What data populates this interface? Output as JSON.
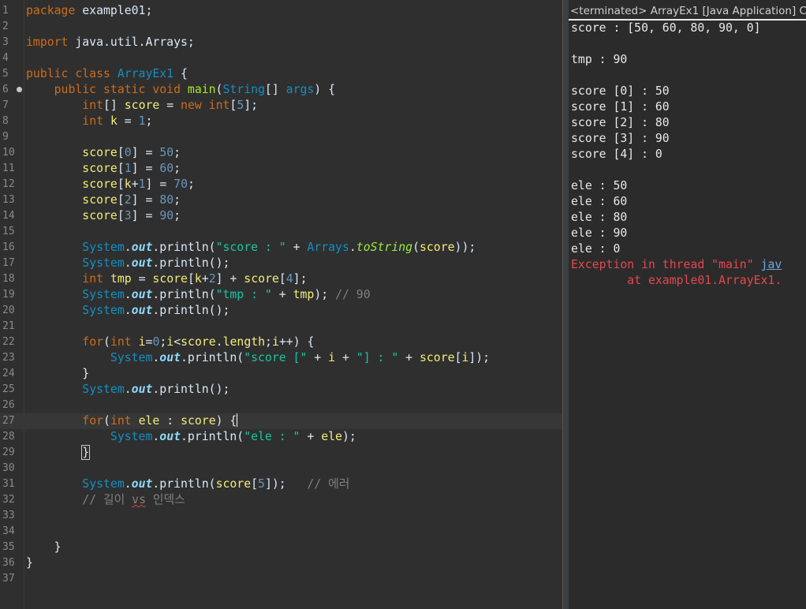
{
  "editor": {
    "lines": [
      {
        "n": "1",
        "tokens": [
          {
            "c": "kw",
            "t": "package"
          },
          {
            "c": "plain",
            "t": " example01;"
          }
        ]
      },
      {
        "n": "2",
        "tokens": []
      },
      {
        "n": "3",
        "tokens": [
          {
            "c": "kw",
            "t": "import"
          },
          {
            "c": "plain",
            "t": " java.util.Arrays;"
          }
        ]
      },
      {
        "n": "4",
        "tokens": []
      },
      {
        "n": "5",
        "tokens": [
          {
            "c": "kw",
            "t": "public class "
          },
          {
            "c": "cls",
            "t": "ArrayEx1"
          },
          {
            "c": "plain",
            "t": " {"
          }
        ]
      },
      {
        "n": "6",
        "fold": true,
        "tokens": [
          {
            "c": "plain",
            "t": "    "
          },
          {
            "c": "kw",
            "t": "public static void "
          },
          {
            "c": "mth",
            "t": "main"
          },
          {
            "c": "plain",
            "t": "("
          },
          {
            "c": "cls",
            "t": "String"
          },
          {
            "c": "plain",
            "t": "[] "
          },
          {
            "c": "type",
            "t": "args"
          },
          {
            "c": "plain",
            "t": ") {"
          }
        ]
      },
      {
        "n": "7",
        "tokens": [
          {
            "c": "plain",
            "t": "        "
          },
          {
            "c": "kw",
            "t": "int"
          },
          {
            "c": "plain",
            "t": "[] "
          },
          {
            "c": "var",
            "t": "score"
          },
          {
            "c": "plain",
            "t": " = "
          },
          {
            "c": "kw",
            "t": "new int"
          },
          {
            "c": "plain",
            "t": "["
          },
          {
            "c": "num",
            "t": "5"
          },
          {
            "c": "plain",
            "t": "];"
          }
        ]
      },
      {
        "n": "8",
        "tokens": [
          {
            "c": "plain",
            "t": "        "
          },
          {
            "c": "kw",
            "t": "int"
          },
          {
            "c": "plain",
            "t": " "
          },
          {
            "c": "var",
            "t": "k"
          },
          {
            "c": "plain",
            "t": " = "
          },
          {
            "c": "num",
            "t": "1"
          },
          {
            "c": "plain",
            "t": ";"
          }
        ]
      },
      {
        "n": "9",
        "tokens": []
      },
      {
        "n": "10",
        "tokens": [
          {
            "c": "plain",
            "t": "        "
          },
          {
            "c": "var",
            "t": "score"
          },
          {
            "c": "plain",
            "t": "["
          },
          {
            "c": "num",
            "t": "0"
          },
          {
            "c": "plain",
            "t": "] = "
          },
          {
            "c": "num",
            "t": "50"
          },
          {
            "c": "plain",
            "t": ";"
          }
        ]
      },
      {
        "n": "11",
        "tokens": [
          {
            "c": "plain",
            "t": "        "
          },
          {
            "c": "var",
            "t": "score"
          },
          {
            "c": "plain",
            "t": "["
          },
          {
            "c": "num",
            "t": "1"
          },
          {
            "c": "plain",
            "t": "] = "
          },
          {
            "c": "num",
            "t": "60"
          },
          {
            "c": "plain",
            "t": ";"
          }
        ]
      },
      {
        "n": "12",
        "tokens": [
          {
            "c": "plain",
            "t": "        "
          },
          {
            "c": "var",
            "t": "score"
          },
          {
            "c": "plain",
            "t": "["
          },
          {
            "c": "var",
            "t": "k"
          },
          {
            "c": "plain",
            "t": "+"
          },
          {
            "c": "num",
            "t": "1"
          },
          {
            "c": "plain",
            "t": "] = "
          },
          {
            "c": "num",
            "t": "70"
          },
          {
            "c": "plain",
            "t": ";"
          }
        ]
      },
      {
        "n": "13",
        "tokens": [
          {
            "c": "plain",
            "t": "        "
          },
          {
            "c": "var",
            "t": "score"
          },
          {
            "c": "plain",
            "t": "["
          },
          {
            "c": "num",
            "t": "2"
          },
          {
            "c": "plain",
            "t": "] = "
          },
          {
            "c": "num",
            "t": "80"
          },
          {
            "c": "plain",
            "t": ";"
          }
        ]
      },
      {
        "n": "14",
        "tokens": [
          {
            "c": "plain",
            "t": "        "
          },
          {
            "c": "var",
            "t": "score"
          },
          {
            "c": "plain",
            "t": "["
          },
          {
            "c": "num",
            "t": "3"
          },
          {
            "c": "plain",
            "t": "] = "
          },
          {
            "c": "num",
            "t": "90"
          },
          {
            "c": "plain",
            "t": ";"
          }
        ]
      },
      {
        "n": "15",
        "tokens": []
      },
      {
        "n": "16",
        "tokens": [
          {
            "c": "plain",
            "t": "        "
          },
          {
            "c": "cls",
            "t": "System"
          },
          {
            "c": "plain",
            "t": "."
          },
          {
            "c": "field",
            "t": "out"
          },
          {
            "c": "plain",
            "t": ".println("
          },
          {
            "c": "str",
            "t": "\"score : \""
          },
          {
            "c": "plain",
            "t": " + "
          },
          {
            "c": "cls",
            "t": "Arrays"
          },
          {
            "c": "plain",
            "t": "."
          },
          {
            "c": "static",
            "t": "toString"
          },
          {
            "c": "plain",
            "t": "("
          },
          {
            "c": "var",
            "t": "score"
          },
          {
            "c": "plain",
            "t": "));"
          }
        ]
      },
      {
        "n": "17",
        "tokens": [
          {
            "c": "plain",
            "t": "        "
          },
          {
            "c": "cls",
            "t": "System"
          },
          {
            "c": "plain",
            "t": "."
          },
          {
            "c": "field",
            "t": "out"
          },
          {
            "c": "plain",
            "t": ".println();"
          }
        ]
      },
      {
        "n": "18",
        "tokens": [
          {
            "c": "plain",
            "t": "        "
          },
          {
            "c": "kw",
            "t": "int"
          },
          {
            "c": "plain",
            "t": " "
          },
          {
            "c": "var",
            "t": "tmp"
          },
          {
            "c": "plain",
            "t": " = "
          },
          {
            "c": "var",
            "t": "score"
          },
          {
            "c": "plain",
            "t": "["
          },
          {
            "c": "var",
            "t": "k"
          },
          {
            "c": "plain",
            "t": "+"
          },
          {
            "c": "num",
            "t": "2"
          },
          {
            "c": "plain",
            "t": "] + "
          },
          {
            "c": "var",
            "t": "score"
          },
          {
            "c": "plain",
            "t": "["
          },
          {
            "c": "num",
            "t": "4"
          },
          {
            "c": "plain",
            "t": "];"
          }
        ]
      },
      {
        "n": "19",
        "tokens": [
          {
            "c": "plain",
            "t": "        "
          },
          {
            "c": "cls",
            "t": "System"
          },
          {
            "c": "plain",
            "t": "."
          },
          {
            "c": "field",
            "t": "out"
          },
          {
            "c": "plain",
            "t": ".println("
          },
          {
            "c": "str",
            "t": "\"tmp : \""
          },
          {
            "c": "plain",
            "t": " + "
          },
          {
            "c": "var",
            "t": "tmp"
          },
          {
            "c": "plain",
            "t": "); "
          },
          {
            "c": "com",
            "t": "// 90"
          }
        ]
      },
      {
        "n": "20",
        "tokens": [
          {
            "c": "plain",
            "t": "        "
          },
          {
            "c": "cls",
            "t": "System"
          },
          {
            "c": "plain",
            "t": "."
          },
          {
            "c": "field",
            "t": "out"
          },
          {
            "c": "plain",
            "t": ".println();"
          }
        ]
      },
      {
        "n": "21",
        "tokens": []
      },
      {
        "n": "22",
        "tokens": [
          {
            "c": "plain",
            "t": "        "
          },
          {
            "c": "kw",
            "t": "for"
          },
          {
            "c": "plain",
            "t": "("
          },
          {
            "c": "kw",
            "t": "int"
          },
          {
            "c": "plain",
            "t": " "
          },
          {
            "c": "var",
            "t": "i"
          },
          {
            "c": "plain",
            "t": "="
          },
          {
            "c": "num",
            "t": "0"
          },
          {
            "c": "plain",
            "t": ";"
          },
          {
            "c": "var",
            "t": "i"
          },
          {
            "c": "plain",
            "t": "<"
          },
          {
            "c": "var",
            "t": "score"
          },
          {
            "c": "plain",
            "t": "."
          },
          {
            "c": "var",
            "t": "length"
          },
          {
            "c": "plain",
            "t": ";"
          },
          {
            "c": "var",
            "t": "i"
          },
          {
            "c": "plain",
            "t": "++) {"
          }
        ]
      },
      {
        "n": "23",
        "tokens": [
          {
            "c": "plain",
            "t": "            "
          },
          {
            "c": "cls",
            "t": "System"
          },
          {
            "c": "plain",
            "t": "."
          },
          {
            "c": "field",
            "t": "out"
          },
          {
            "c": "plain",
            "t": ".println("
          },
          {
            "c": "str",
            "t": "\"score [\""
          },
          {
            "c": "plain",
            "t": " + "
          },
          {
            "c": "var",
            "t": "i"
          },
          {
            "c": "plain",
            "t": " + "
          },
          {
            "c": "str",
            "t": "\"] : \""
          },
          {
            "c": "plain",
            "t": " + "
          },
          {
            "c": "var",
            "t": "score"
          },
          {
            "c": "plain",
            "t": "["
          },
          {
            "c": "var",
            "t": "i"
          },
          {
            "c": "plain",
            "t": "]);"
          }
        ]
      },
      {
        "n": "24",
        "tokens": [
          {
            "c": "plain",
            "t": "        }"
          }
        ]
      },
      {
        "n": "25",
        "tokens": [
          {
            "c": "plain",
            "t": "        "
          },
          {
            "c": "cls",
            "t": "System"
          },
          {
            "c": "plain",
            "t": "."
          },
          {
            "c": "field",
            "t": "out"
          },
          {
            "c": "plain",
            "t": ".println();"
          }
        ]
      },
      {
        "n": "26",
        "tokens": []
      },
      {
        "n": "27",
        "current": true,
        "tokens": [
          {
            "c": "plain",
            "t": "        "
          },
          {
            "c": "kw",
            "t": "for"
          },
          {
            "c": "plain",
            "t": "("
          },
          {
            "c": "kw",
            "t": "int"
          },
          {
            "c": "plain",
            "t": " "
          },
          {
            "c": "var",
            "t": "ele"
          },
          {
            "c": "plain",
            "t": " : "
          },
          {
            "c": "var",
            "t": "score"
          },
          {
            "c": "plain",
            "t": ") {"
          },
          {
            "c": "cursor",
            "t": ""
          }
        ]
      },
      {
        "n": "28",
        "tokens": [
          {
            "c": "plain",
            "t": "            "
          },
          {
            "c": "cls",
            "t": "System"
          },
          {
            "c": "plain",
            "t": "."
          },
          {
            "c": "field",
            "t": "out"
          },
          {
            "c": "plain",
            "t": ".println("
          },
          {
            "c": "str",
            "t": "\"ele : \""
          },
          {
            "c": "plain",
            "t": " + "
          },
          {
            "c": "var",
            "t": "ele"
          },
          {
            "c": "plain",
            "t": ");"
          }
        ]
      },
      {
        "n": "29",
        "tokens": [
          {
            "c": "plain",
            "t": "        "
          },
          {
            "c": "box",
            "t": "}"
          }
        ]
      },
      {
        "n": "30",
        "tokens": []
      },
      {
        "n": "31",
        "tokens": [
          {
            "c": "plain",
            "t": "        "
          },
          {
            "c": "cls",
            "t": "System"
          },
          {
            "c": "plain",
            "t": "."
          },
          {
            "c": "field",
            "t": "out"
          },
          {
            "c": "plain",
            "t": ".println("
          },
          {
            "c": "var",
            "t": "score"
          },
          {
            "c": "plain",
            "t": "["
          },
          {
            "c": "num",
            "t": "5"
          },
          {
            "c": "plain",
            "t": "]);   "
          },
          {
            "c": "com",
            "t": "// 에러"
          }
        ]
      },
      {
        "n": "32",
        "tokens": [
          {
            "c": "plain",
            "t": "        "
          },
          {
            "c": "com",
            "t": "// 길이 "
          },
          {
            "c": "comsq",
            "t": "vs"
          },
          {
            "c": "com",
            "t": " 인덱스"
          }
        ]
      },
      {
        "n": "33",
        "tokens": []
      },
      {
        "n": "34",
        "tokens": []
      },
      {
        "n": "35",
        "tokens": [
          {
            "c": "plain",
            "t": "    }"
          }
        ]
      },
      {
        "n": "36",
        "tokens": [
          {
            "c": "plain",
            "t": "}"
          }
        ]
      },
      {
        "n": "37",
        "tokens": []
      }
    ]
  },
  "console": {
    "title": "<terminated> ArrayEx1 [Java Application] C",
    "lines": [
      {
        "text": "score : [50, 60, 80, 90, 0]"
      },
      {
        "text": ""
      },
      {
        "text": "tmp : 90"
      },
      {
        "text": ""
      },
      {
        "text": "score [0] : 50"
      },
      {
        "text": "score [1] : 60"
      },
      {
        "text": "score [2] : 80"
      },
      {
        "text": "score [3] : 90"
      },
      {
        "text": "score [4] : 0"
      },
      {
        "text": ""
      },
      {
        "text": "ele : 50"
      },
      {
        "text": "ele : 60"
      },
      {
        "text": "ele : 80"
      },
      {
        "text": "ele : 90"
      },
      {
        "text": "ele : 0"
      },
      {
        "text": "Exception in thread \"main\" ",
        "err": true,
        "link": "jav"
      },
      {
        "text": "        at example01.ArrayEx1.",
        "err": true
      }
    ]
  },
  "colors": {
    "keyword": "#cc6c1d",
    "type": "#1290c3",
    "method": "#a7ec21",
    "variable": "#f3ec79",
    "string": "#17c6a3",
    "number": "#6897bb",
    "comment": "#808080",
    "error": "#e5484d"
  }
}
